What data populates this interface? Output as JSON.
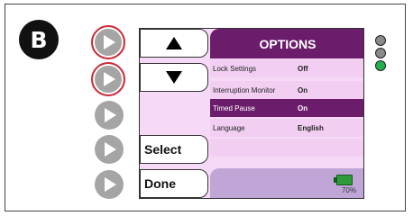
{
  "badge": "B",
  "screen": {
    "header": "OPTIONS",
    "menu": {
      "select": "Select",
      "done": "Done"
    },
    "rows": [
      {
        "label": "Lock Settings",
        "value": "Off"
      },
      {
        "label": "Interruption Monitor",
        "value": "On"
      },
      {
        "label": "Timed Pause",
        "value": "On"
      },
      {
        "label": "Language",
        "value": "English"
      }
    ],
    "selected_row": 3,
    "battery_percent": "70%"
  },
  "side_buttons": [
    "play-icon",
    "play-icon",
    "play-icon",
    "play-icon",
    "play-icon"
  ],
  "indicator_lights": [
    {
      "state": "off",
      "color": "#8a8a8a"
    },
    {
      "state": "off",
      "color": "#8a8a8a"
    },
    {
      "state": "on",
      "color": "#21b04b"
    }
  ],
  "colors": {
    "accent_purple": "#6b1d6b",
    "screen_bg": "#f6d9f6",
    "highlight_ring": "#cc2b3a"
  }
}
